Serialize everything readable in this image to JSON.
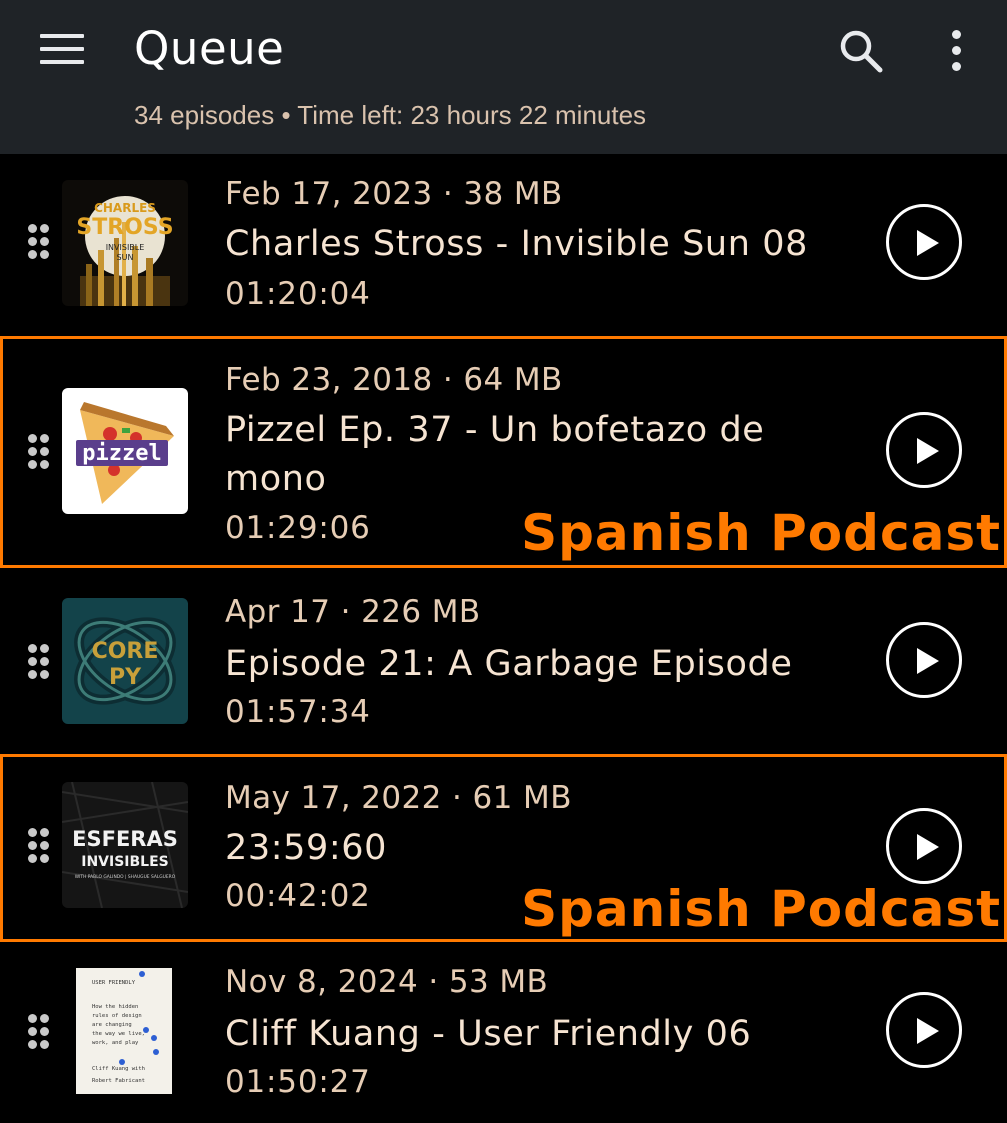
{
  "header": {
    "title": "Queue",
    "subtitle": "34 episodes • Time left: 23 hours 22 minutes"
  },
  "episodes": [
    {
      "meta": "Feb 17, 2023 · 38 MB",
      "title": "Charles Stross - Invisible Sun 08",
      "duration": "01:20:04",
      "art": {
        "line1": "CHARLES",
        "line2": "STROSS",
        "line3": "INVISIBLE",
        "line4": "SUN"
      }
    },
    {
      "meta": "Feb 23, 2018 · 64 MB",
      "title": "Pizzel Ep. 37 - Un bofetazo de mono",
      "duration": "01:29:06",
      "art": {
        "line1": "pizzel"
      },
      "annotation": "Spanish Podcast"
    },
    {
      "meta": "Apr 17 · 226 MB",
      "title": "Episode 21: A Garbage Episode",
      "duration": "01:57:34",
      "art": {
        "line1": "CORE",
        "line2": "PY"
      }
    },
    {
      "meta": "May 17, 2022 · 61 MB",
      "title": "23:59:60",
      "duration": "00:42:02",
      "art": {
        "line1": "ESFERAS",
        "line2": "INVISIBLES",
        "line3": "WITH PABLO GALINDO | SHAUGUE SALGUERO"
      },
      "annotation": "Spanish Podcast"
    },
    {
      "meta": "Nov 8, 2024 · 53 MB",
      "title": "Cliff Kuang - User Friendly 06",
      "duration": "01:50:27",
      "art": {
        "line1": "USER FRIENDLY",
        "line2": "How the hidden",
        "line3": "rules of design",
        "line4": "are changing",
        "line5": "the way we live,",
        "line6": "work, and play",
        "line7": "Cliff Kuang with",
        "line8": "Robert Fabricant"
      }
    }
  ],
  "colors": {
    "appbar": "#1f2327",
    "background": "#000000",
    "text": "#f2dcc6",
    "highlight": "#ff7a00"
  }
}
